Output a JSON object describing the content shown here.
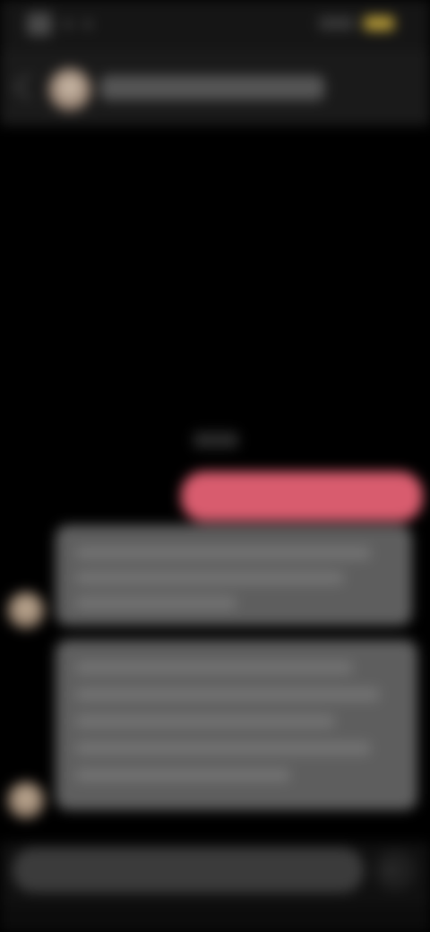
{
  "app": {
    "type": "messaging-chat-screen"
  },
  "status_bar": {
    "time": "",
    "battery_color": "#b59a38"
  },
  "header": {
    "contact_name": "",
    "back_icon": "chevron-left-icon",
    "avatar_icon": "contact-avatar"
  },
  "chat": {
    "timestamp": "",
    "messages": [
      {
        "direction": "outgoing",
        "text": "",
        "color": "#d85c6e"
      },
      {
        "direction": "incoming",
        "text": "",
        "color": "#5e5e5e"
      },
      {
        "direction": "incoming",
        "text": "",
        "color": "#5e5e5e"
      }
    ]
  },
  "composer": {
    "value": "",
    "placeholder": "",
    "send_icon": "send-icon"
  },
  "colors": {
    "background": "#000000",
    "header": "#1a1a1a",
    "outgoing_bubble": "#d85c6e",
    "incoming_bubble": "#5e5e5e",
    "input": "#3b3b3b"
  }
}
